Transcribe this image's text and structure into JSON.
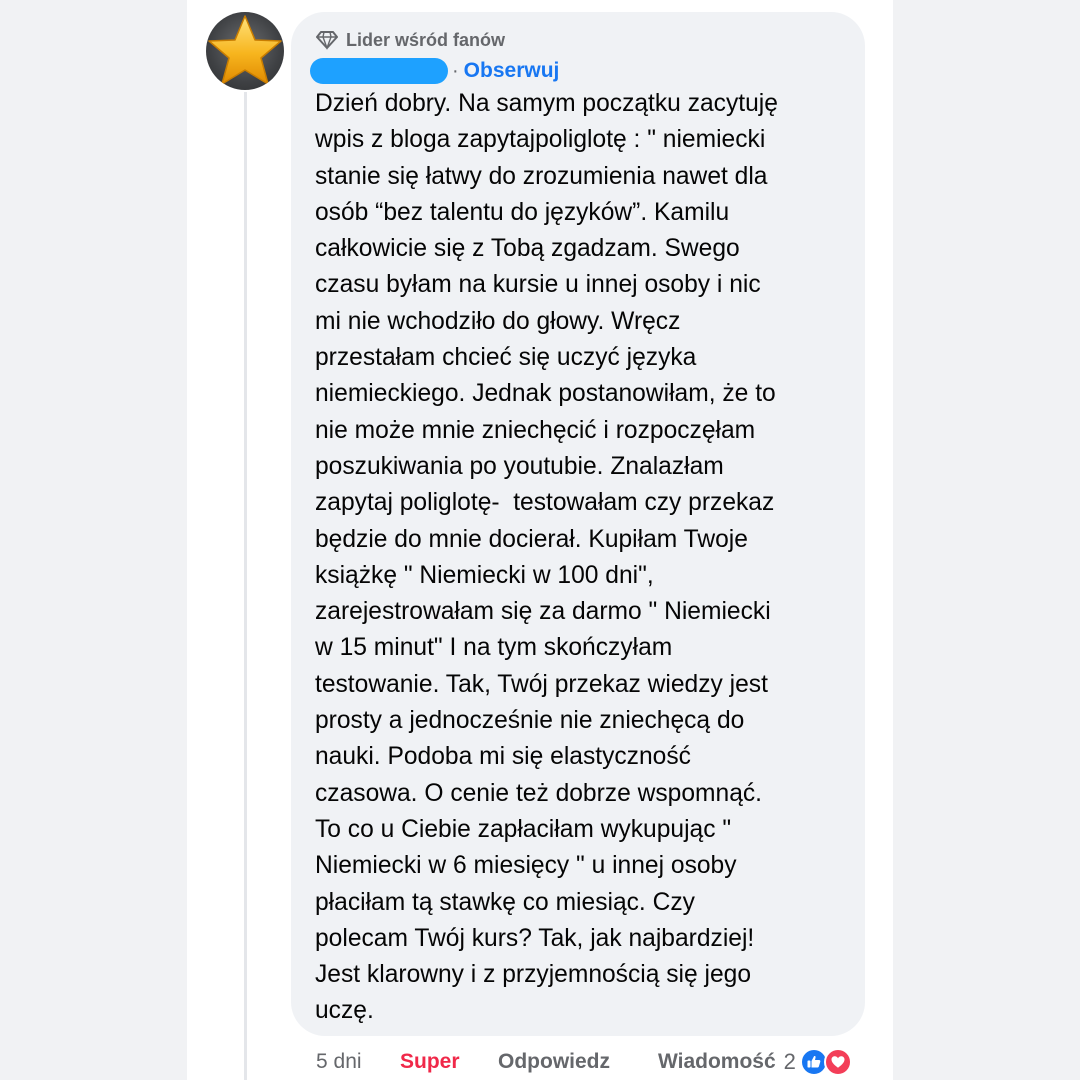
{
  "badge": {
    "label": "Lider wśród fanów",
    "icon": "diamond-icon"
  },
  "author": {
    "name": "",
    "follow_label": "Obserwuj",
    "separator": "·"
  },
  "avatar": {
    "icon": "star-icon"
  },
  "comment": {
    "lines": [
      "Dzień dobry. Na samym początku zacytuję",
      "wpis z bloga zapytajpoliglotę : \" niemiecki",
      "stanie się łatwy do zrozumienia nawet dla",
      "osób “bez talentu do języków”. Kamilu",
      "całkowicie się z Tobą zgadzam. Swego",
      "czasu byłam na kursie u innej osoby i nic",
      "mi nie wchodziło do głowy. Wręcz",
      "przestałam chcieć się uczyć języka",
      "niemieckiego. Jednak postanowiłam, że to",
      "nie może mnie zniechęcić i rozpoczęłam",
      "poszukiwania po youtubie. Znalazłam",
      "zapytaj poliglotę-  testowałam czy przekaz",
      "będzie do mnie docierał. Kupiłam Twoje",
      "książkę \" Niemiecki w 100 dni\",",
      "zarejestrowałam się za darmo \" Niemiecki",
      "w 15 minut\" I na tym skończyłam",
      "testowanie. Tak, Twój przekaz wiedzy jest",
      "prosty a jednocześnie nie zniechęcą do",
      "nauki. Podoba mi się elastyczność",
      "czasowa. O cenie też dobrze wspomnąć.",
      "To co u Ciebie zapłaciłam wykupując \"",
      "Niemiecki w 6 miesięcy \" u innej osoby",
      "płaciłam tą stawkę co miesiąc. Czy",
      "polecam Twój kurs? Tak, jak najbardziej!",
      "Jest klarowny i z przyjemnością się jego",
      "uczę."
    ]
  },
  "actions": {
    "time": "5 dni",
    "reaction_label": "Super",
    "reply_label": "Odpowiedz",
    "message_label": "Wiadomość",
    "reaction_count": "2",
    "reactions": [
      "like-icon",
      "love-icon"
    ]
  },
  "colors": {
    "accent": "#1877f2",
    "super": "#f02849",
    "bubble": "#f0f2f5",
    "muted": "#65676b"
  }
}
